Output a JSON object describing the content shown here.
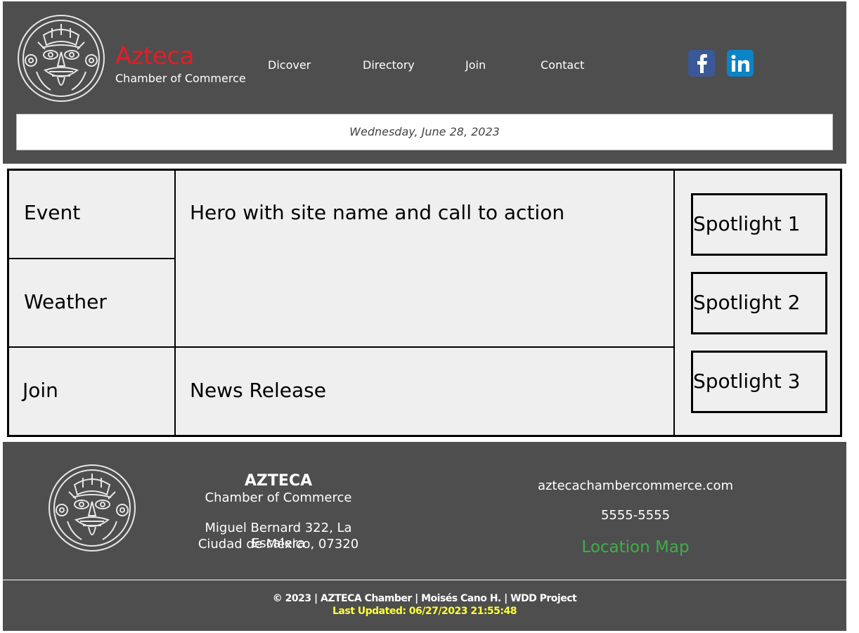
{
  "header": {
    "logo_icon": "aztec-mask-logo-icon",
    "brand_name": "Azteca",
    "brand_sub": "Chamber of Commerce",
    "nav": [
      "Dicover",
      "Directory",
      "Join",
      "Contact"
    ],
    "social": [
      {
        "name": "facebook-icon",
        "color": "#3b5998"
      },
      {
        "name": "linkedin-icon",
        "color": "#0a84c6"
      }
    ],
    "date": "Wednesday, June 28, 2023"
  },
  "grid": {
    "event": "Event",
    "weather": "Weather",
    "join": "Join",
    "hero": "Hero with site name and call to action",
    "news": "News Release",
    "spotlights": [
      "Spotlight 1",
      "Spotlight 2",
      "Spotlight 3"
    ]
  },
  "footer": {
    "title": "AZTECA",
    "subtitle": "Chamber of Commerce",
    "address_line1": "Miguel Bernard 322, La Escalera",
    "address_line2": "Ciudad de México, 07320",
    "website": "aztecachambercommerce.com",
    "phone": "5555-5555",
    "map_link": "Location Map",
    "copyright": "© 2023 | AZTECA Chamber | Moisés Cano H. | WDD Project",
    "last_updated": "Last Updated: 06/27/2023 21:55:48"
  },
  "colors": {
    "header_bg": "#4e4e4e",
    "brand_red": "#e41e26",
    "map_green": "#3fae48",
    "updated_yellow": "#ffff3a"
  }
}
